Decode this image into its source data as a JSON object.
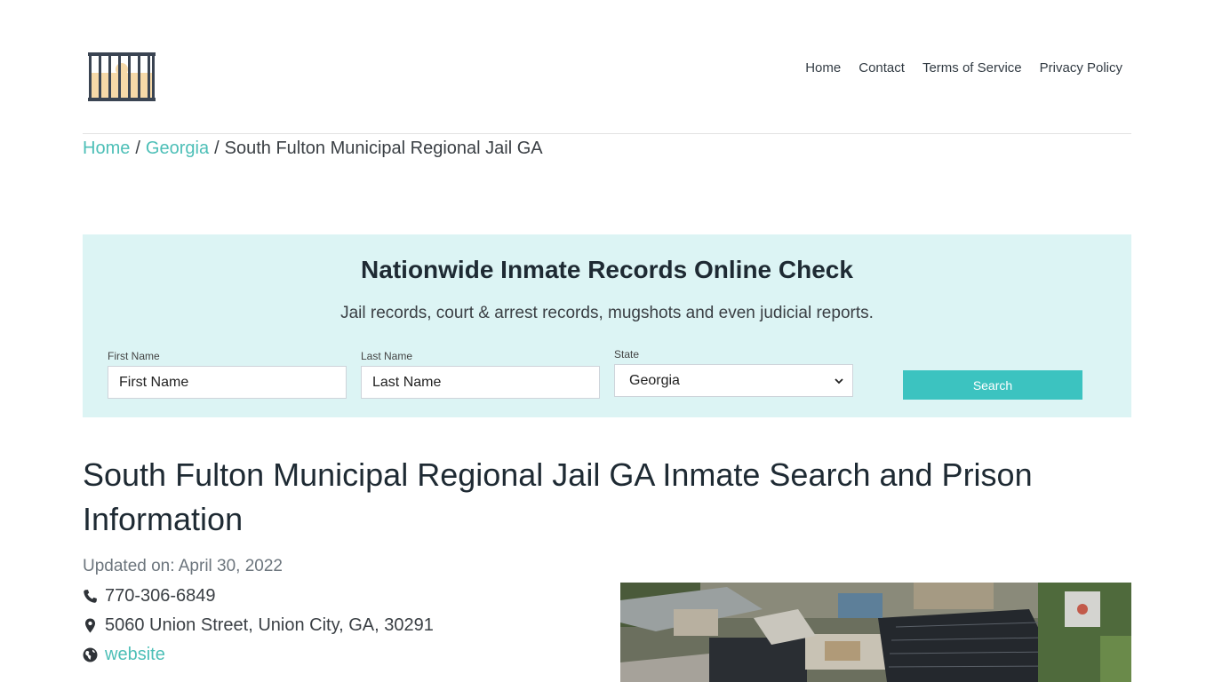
{
  "nav": {
    "home": "Home",
    "contact": "Contact",
    "terms": "Terms of Service",
    "privacy": "Privacy Policy"
  },
  "breadcrumb": {
    "home": "Home",
    "sep1": "/",
    "state": "Georgia",
    "sep2": "/",
    "current": "South Fulton Municipal Regional Jail GA"
  },
  "search": {
    "title": "Nationwide Inmate Records Online Check",
    "subtitle": "Jail records, court & arrest records, mugshots and even judicial reports.",
    "first_name_label": "First Name",
    "first_name_placeholder": "First Name",
    "last_name_label": "Last Name",
    "last_name_placeholder": "Last Name",
    "state_label": "State",
    "state_value": "Georgia",
    "button": "Search"
  },
  "main": {
    "heading": "South Fulton Municipal Regional Jail GA Inmate Search and Prison Information",
    "updated": "Updated on: April 30, 2022",
    "phone": "770-306-6849",
    "address": "5060 Union Street, Union City, GA, 30291",
    "website": "website"
  },
  "colors": {
    "accent": "#4dbfb7",
    "button": "#3cc3c0",
    "panel": "#dcf4f4"
  }
}
